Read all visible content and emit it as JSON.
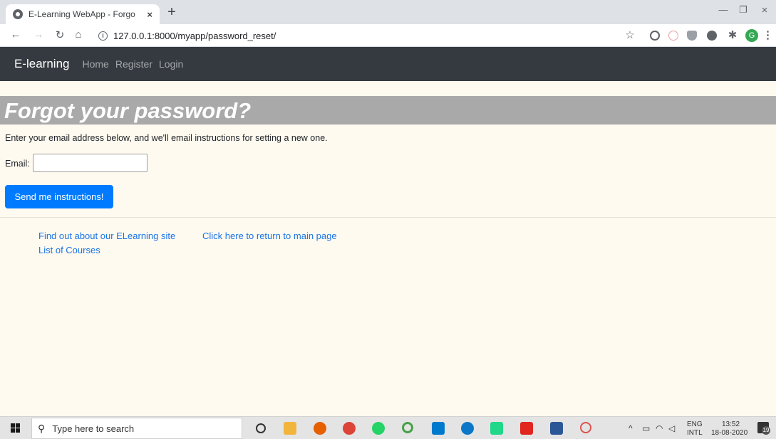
{
  "browser": {
    "tab_title": "E-Learning WebApp - Forgot Your Password",
    "tab_close": "×",
    "new_tab": "+",
    "url": "127.0.0.1:8000/myapp/password_reset/",
    "profile_initial": "G",
    "window_controls": {
      "minimize": "—",
      "restore": "❐",
      "close": "×"
    }
  },
  "navbar": {
    "brand": "E-learning",
    "links": [
      "Home",
      "Register",
      "Login"
    ]
  },
  "page": {
    "title": "Forgot your password?",
    "instructions": "Enter your email address below, and we'll email instructions for setting a new one.",
    "email_label": "Email:",
    "email_value": "",
    "submit_label": "Send me instructions!"
  },
  "footer": {
    "links": [
      "Find out about our ELearning site",
      "Click here to return to main page",
      "List of Courses"
    ]
  },
  "taskbar": {
    "search_placeholder": "Type here to search",
    "language_line1": "ENG",
    "language_line2": "INTL",
    "time": "13:52",
    "date": "18-08-2020",
    "notification_count": "19"
  },
  "colors": {
    "navbar_bg": "#343a40",
    "page_bg": "#fffaf0",
    "title_band": "#a9a9a9",
    "primary_button": "#007bff",
    "link": "#1a73e8"
  }
}
